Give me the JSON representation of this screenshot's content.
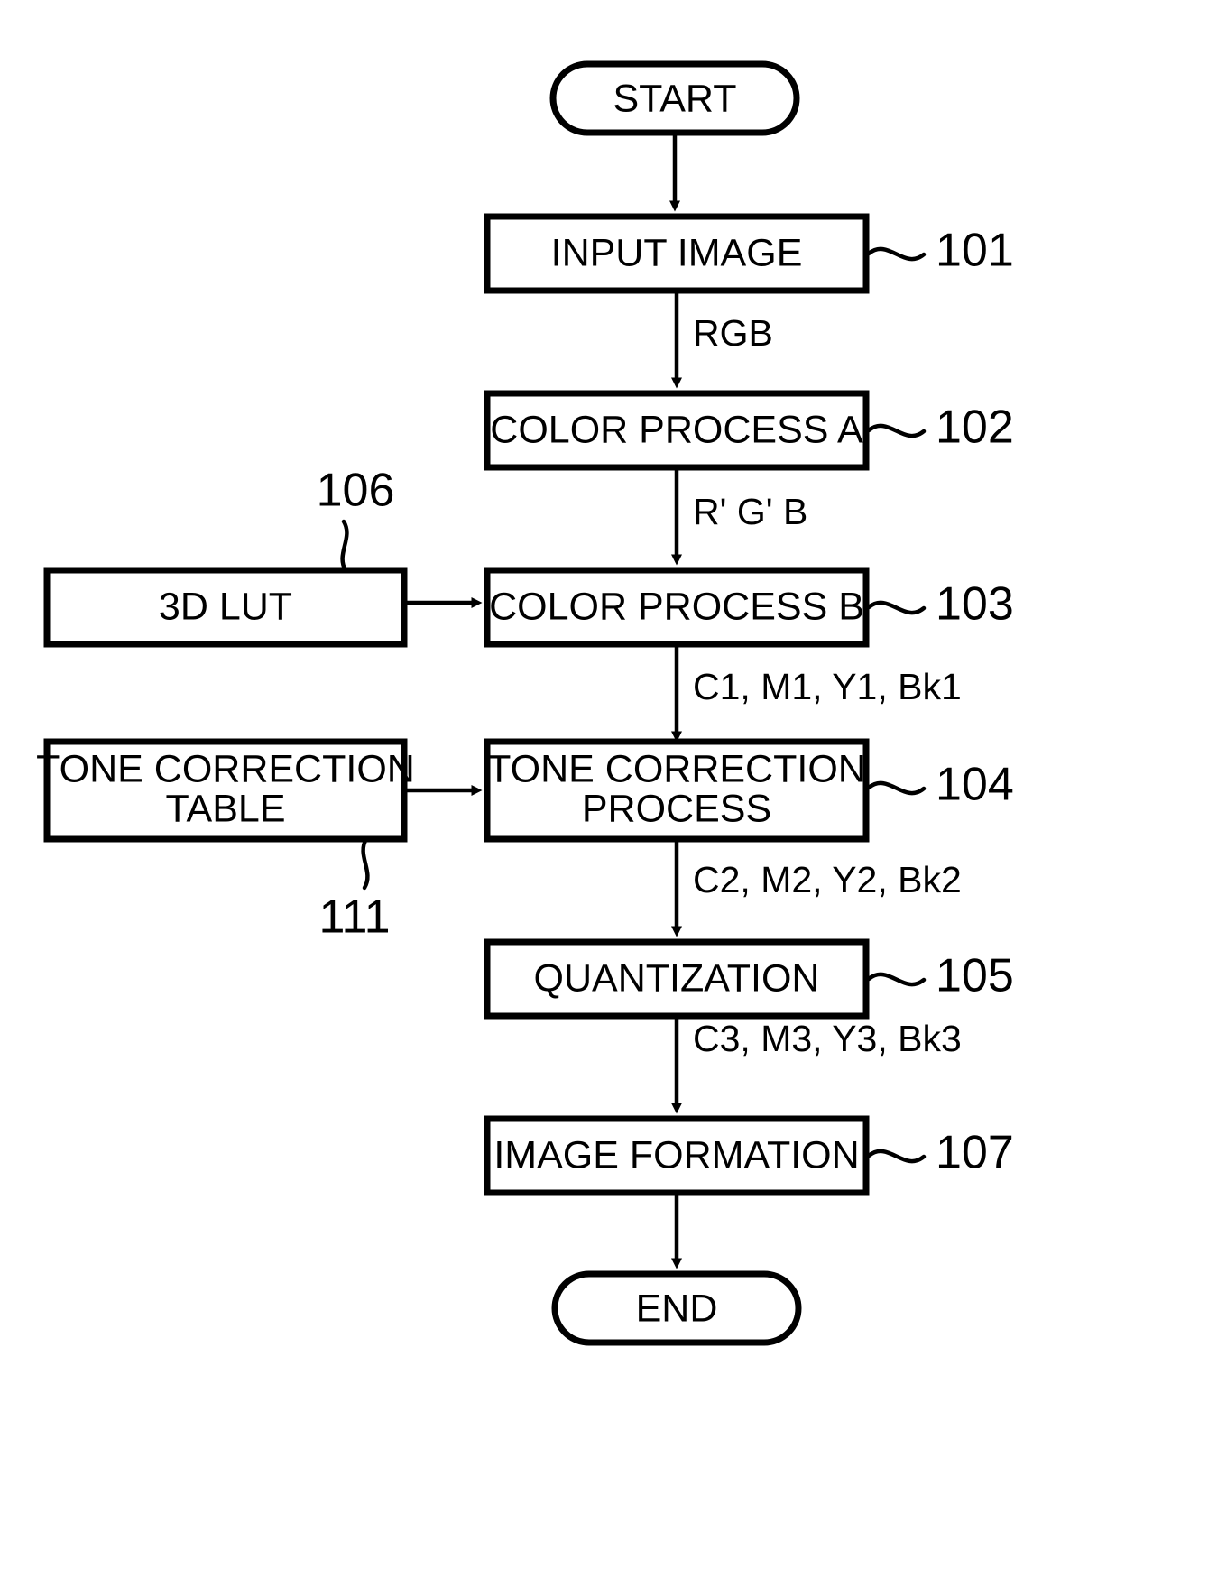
{
  "figure": {
    "type": "patent-flowchart",
    "background_color": "#ffffff",
    "line_color": "#000000"
  },
  "terminators": {
    "start": "START",
    "end": "END"
  },
  "process_boxes": [
    {
      "id": "101",
      "label": "INPUT IMAGE",
      "ref": "101"
    },
    {
      "id": "102",
      "label": "COLOR PROCESS A",
      "ref": "102"
    },
    {
      "id": "103",
      "label": "COLOR PROCESS B",
      "ref": "103"
    },
    {
      "id": "104",
      "label_line1": "TONE CORRECTION",
      "label_line2": "PROCESS",
      "ref": "104"
    },
    {
      "id": "105",
      "label": "QUANTIZATION",
      "ref": "105"
    },
    {
      "id": "107",
      "label": "IMAGE FORMATION",
      "ref": "107"
    }
  ],
  "side_boxes": [
    {
      "id": "106",
      "label": "3D  LUT",
      "ref": "106"
    },
    {
      "id": "111",
      "label_line1": "TONE CORRECTION",
      "label_line2": "TABLE",
      "ref": "111"
    }
  ],
  "edge_labels": {
    "start_to_input": "",
    "input_to_colorA": "RGB",
    "colorA_to_colorB": "R'  G'  B",
    "colorB_to_tone": "C1, M1, Y1, Bk1",
    "tone_to_quant": "C2, M2, Y2, Bk2",
    "quant_to_imageform": "C3, M3, Y3, Bk3",
    "imageform_to_end": ""
  },
  "reference_numerals": {
    "input_image": "101",
    "color_process_a": "102",
    "color_process_b": "103",
    "tone_correction_process": "104",
    "quantization": "105",
    "lut_3d": "106",
    "image_formation": "107",
    "tone_correction_table": "111"
  },
  "labels": {
    "start_text": "START",
    "input_image_text": "INPUT IMAGE",
    "color_process_a_text": "COLOR PROCESS A",
    "color_process_b_text": "COLOR PROCESS B",
    "tone_correction_process_l1": "TONE CORRECTION",
    "tone_correction_process_l2": "PROCESS",
    "quantization_text": "QUANTIZATION",
    "image_formation_text": "IMAGE FORMATION",
    "end_text": "END",
    "lut_3d_text": "3D  LUT",
    "tone_correction_table_l1": "TONE CORRECTION",
    "tone_correction_table_l2": "TABLE",
    "rgb_text": "RGB",
    "rgb_prime_text": "R'  G'  B",
    "cmyk1_text": "C1, M1, Y1, Bk1",
    "cmyk2_text": "C2, M2, Y2, Bk2",
    "cmyk3_text": "C3, M3, Y3, Bk3",
    "ref_101": "101",
    "ref_102": "102",
    "ref_103": "103",
    "ref_104": "104",
    "ref_105": "105",
    "ref_106": "106",
    "ref_107": "107",
    "ref_111": "111"
  }
}
